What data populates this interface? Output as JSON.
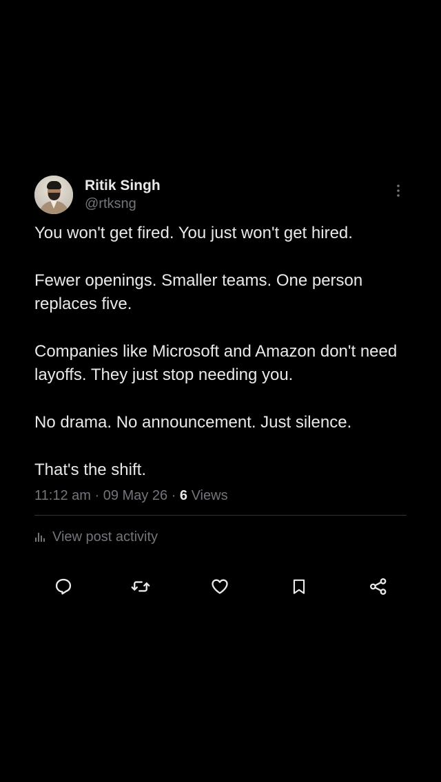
{
  "post": {
    "author": {
      "display_name": "Ritik Singh",
      "handle": "@rtksng",
      "avatar_icon": "avatar-photo"
    },
    "paragraphs": [
      "You won't get fired. You just won't get hired.",
      "Fewer openings. Smaller teams. One person replaces five.",
      "Companies like Microsoft and Amazon don't need layoffs. They just stop needing you.",
      "No drama. No announcement. Just silence.",
      "That's the shift."
    ],
    "time": "11:12 am",
    "date": "09 May 26",
    "separator": "·",
    "views_count": "6",
    "views_label": "Views",
    "activity_label": "View post activity"
  },
  "actions": [
    {
      "name": "reply",
      "icon": "reply-icon"
    },
    {
      "name": "repost",
      "icon": "repost-icon"
    },
    {
      "name": "like",
      "icon": "heart-icon"
    },
    {
      "name": "bookmark",
      "icon": "bookmark-icon"
    },
    {
      "name": "share",
      "icon": "share-icon"
    }
  ],
  "colors": {
    "background": "#000000",
    "primary_text": "#e7e9ea",
    "secondary_text": "#71767b",
    "divider": "#2f3336"
  }
}
